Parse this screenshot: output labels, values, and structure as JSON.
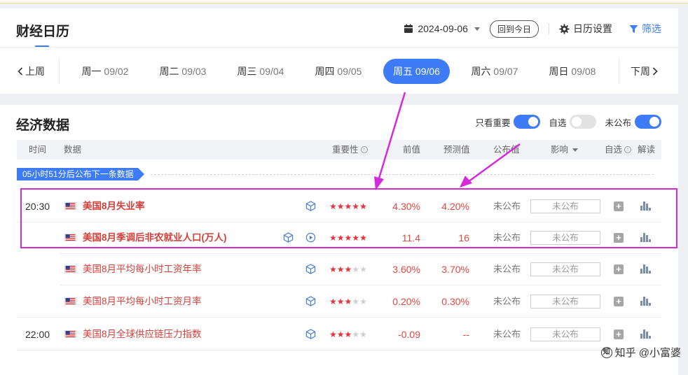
{
  "header": {
    "title": "财经日历",
    "date": "2024-09-06",
    "today_btn": "回到今日",
    "calendar_settings": "日历设置",
    "filter": "筛选"
  },
  "week": {
    "prev": "上周",
    "next": "下周",
    "days": [
      {
        "wd": "周一",
        "date": "09/02",
        "active": false
      },
      {
        "wd": "周二",
        "date": "09/03",
        "active": false
      },
      {
        "wd": "周三",
        "date": "09/04",
        "active": false
      },
      {
        "wd": "周四",
        "date": "09/05",
        "active": false
      },
      {
        "wd": "周五",
        "date": "09/06",
        "active": true
      },
      {
        "wd": "周六",
        "date": "09/07",
        "active": false
      },
      {
        "wd": "周日",
        "date": "09/08",
        "active": false
      }
    ]
  },
  "econ": {
    "title": "经济数据",
    "toggles": [
      {
        "label": "只看重要",
        "on": true
      },
      {
        "label": "自选",
        "on": false
      },
      {
        "label": "未公布",
        "on": true
      }
    ],
    "columns": {
      "time": "时间",
      "data": "数据",
      "importance": "重要性",
      "prev": "前值",
      "forecast": "预测值",
      "actual": "公布值",
      "impact": "影响",
      "watch": "自选",
      "interpret": "解读"
    },
    "banner": "05小时51分后公布下一条数据",
    "rows": [
      {
        "time": "20:30",
        "name": "美国8月失业率",
        "bold": true,
        "stars": 5,
        "prev": "4.30%",
        "forecast": "4.20%",
        "actual": "未公布",
        "impact": "未公布",
        "video": false
      },
      {
        "time": "",
        "name": "美国8月季调后非农就业人口(万人)",
        "bold": true,
        "stars": 5,
        "prev": "11.4",
        "forecast": "16",
        "actual": "未公布",
        "impact": "未公布",
        "video": true
      },
      {
        "time": "",
        "name": "美国8月平均每小时工资年率",
        "bold": false,
        "stars": 3,
        "prev": "3.60%",
        "forecast": "3.70%",
        "actual": "未公布",
        "impact": "未公布",
        "video": false
      },
      {
        "time": "",
        "name": "美国8月平均每小时工资月率",
        "bold": false,
        "stars": 3,
        "prev": "0.20%",
        "forecast": "0.30%",
        "actual": "未公布",
        "impact": "未公布",
        "video": false
      },
      {
        "time": "22:00",
        "name": "美国8月全球供应链压力指数",
        "bold": false,
        "stars": 3,
        "prev": "-0.09",
        "forecast": "--",
        "actual": "未公布",
        "impact": "未公布",
        "video": false
      }
    ]
  },
  "watermark": "知乎 @小富婆",
  "colors": {
    "accent": "#3d7bf7",
    "red": "#d43f3a",
    "highlight": "#d32bd9"
  },
  "icons": [
    "calendar-icon",
    "caret-down-icon",
    "gear-icon",
    "filter-icon",
    "chevron-left-icon",
    "chevron-right-icon",
    "us-flag-icon",
    "cube-icon",
    "play-icon",
    "plus-icon",
    "bar-chart-icon"
  ]
}
